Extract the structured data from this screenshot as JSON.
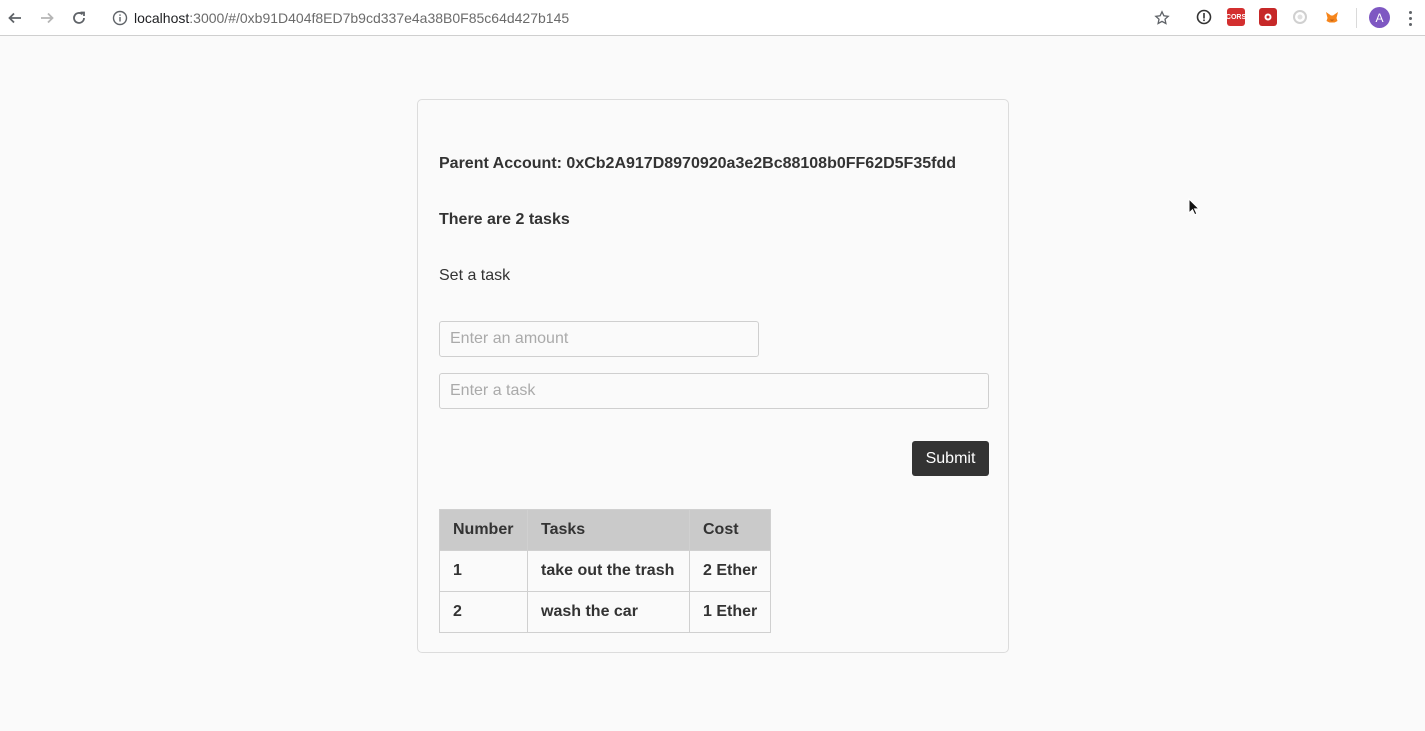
{
  "browser": {
    "url_host": "localhost",
    "url_rest": ":3000/#/0xb91D404f8ED7b9cd337e4a38B0F85c64d427b145",
    "profile_initial": "A",
    "extensions": [
      {
        "name": "cors-extension-icon",
        "label": "CORS",
        "color": "#d32f2f"
      },
      {
        "name": "extension-red-icon",
        "label": "",
        "color": "#c62828"
      },
      {
        "name": "extension-circle-icon",
        "label": "",
        "color": "#e0e0e0"
      },
      {
        "name": "metamask-fox-icon",
        "label": "",
        "color": "#f6851b"
      }
    ]
  },
  "page": {
    "parent_account_label": "Parent Account: 0xCb2A917D8970920a3e2Bc88108b0FF62D5F35fdd",
    "task_count_text": "There are 2 tasks",
    "set_task_heading": "Set a task",
    "amount_placeholder": "Enter an amount",
    "task_placeholder": "Enter a task",
    "submit_label": "Submit"
  },
  "table": {
    "headers": [
      "Number",
      "Tasks",
      "Cost"
    ],
    "rows": [
      [
        "1",
        "take out the trash",
        "2 Ether"
      ],
      [
        "2",
        "wash the car",
        "1 Ether"
      ]
    ]
  },
  "colors": {
    "button_bg": "#333333",
    "header_bg": "#cacaca",
    "page_bg": "#fafafa"
  }
}
